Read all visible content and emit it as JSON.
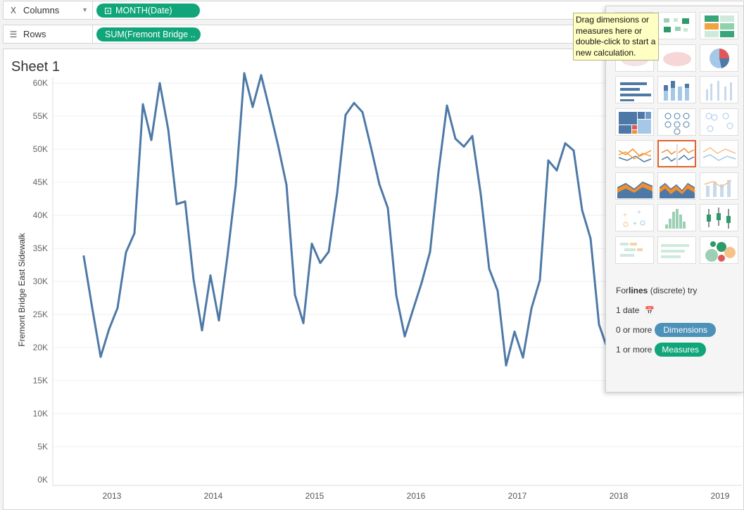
{
  "shelves": {
    "columns": {
      "label": "Columns",
      "pill": "MONTH(Date)"
    },
    "rows": {
      "label": "Rows",
      "pill": "SUM(Fremont Bridge .."
    }
  },
  "sheet": {
    "title": "Sheet 1"
  },
  "chart_data": {
    "type": "line",
    "title": "",
    "ylabel": "Fremont Bridge East Sidewalk",
    "xlabel": "",
    "ylim": [
      0,
      63000
    ],
    "y_ticks": [
      "0K",
      "5K",
      "10K",
      "15K",
      "20K",
      "25K",
      "30K",
      "35K",
      "40K",
      "45K",
      "50K",
      "55K",
      "60K"
    ],
    "x_ticks": [
      "2013",
      "2014",
      "2015",
      "2016",
      "2017",
      "2018",
      "2019"
    ],
    "x": [
      "2012-10",
      "2012-11",
      "2012-12",
      "2013-01",
      "2013-02",
      "2013-03",
      "2013-04",
      "2013-05",
      "2013-06",
      "2013-07",
      "2013-08",
      "2013-09",
      "2013-10",
      "2013-11",
      "2013-12",
      "2014-01",
      "2014-02",
      "2014-03",
      "2014-04",
      "2014-05",
      "2014-06",
      "2014-07",
      "2014-08",
      "2014-09",
      "2014-10",
      "2014-11",
      "2014-12",
      "2015-01",
      "2015-02",
      "2015-03",
      "2015-04",
      "2015-05",
      "2015-06",
      "2015-07",
      "2015-08",
      "2015-09",
      "2015-10",
      "2015-11",
      "2015-12",
      "2016-01",
      "2016-02",
      "2016-03",
      "2016-04",
      "2016-05",
      "2016-06",
      "2016-07",
      "2016-08",
      "2016-09",
      "2016-10",
      "2016-11",
      "2016-12",
      "2017-01",
      "2017-02",
      "2017-03",
      "2017-04",
      "2017-05",
      "2017-06",
      "2017-07",
      "2017-08",
      "2017-09",
      "2017-10",
      "2017-11",
      "2017-12"
    ],
    "series": [
      {
        "values": [
          33800,
          26000,
          18600,
          22800,
          26000,
          34400,
          37300,
          56800,
          51400,
          60000,
          53000,
          41700,
          42100,
          30300,
          22600,
          30900,
          24100,
          33700,
          44600,
          61500,
          56400,
          61200,
          56000,
          50600,
          44600,
          28000,
          23700,
          35700,
          32800,
          34500,
          43400,
          55200,
          57000,
          55600,
          50300,
          44700,
          41100,
          27900,
          21700,
          25800,
          29800,
          34500,
          46600,
          56600,
          51600,
          50400,
          52000,
          43200,
          31900,
          28600,
          17300,
          22400,
          18500,
          25900,
          30200,
          48300,
          46800,
          50900,
          49800,
          40800,
          36500,
          23500,
          19800
        ]
      }
    ],
    "colors": {
      "line": "#4e79a7"
    },
    "grid": "horizontal"
  },
  "show_me": {
    "tooltip": [
      "Drag dimensions or",
      "measures here or",
      "double-click to start a",
      "new calculation."
    ],
    "hint_title_pre": "For ",
    "hint_title_bold": "lines",
    "hint_title_post": " (discrete) try",
    "hint_date": "1 date",
    "hint_dims_pre": "0 or more",
    "hint_dims_pill": "Dimensions",
    "hint_meas_pre": "1 or more",
    "hint_meas_pill": "Measures",
    "colors": {
      "dimensions": "#4c91b8",
      "measures": "#11a57a",
      "selected": "#e0622b"
    }
  }
}
